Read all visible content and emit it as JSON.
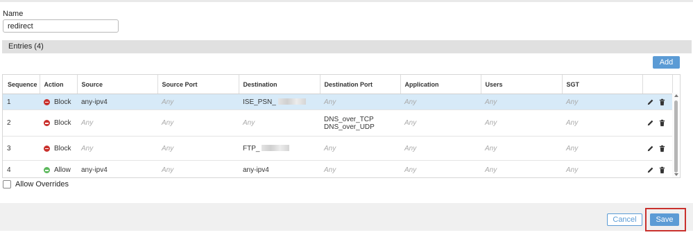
{
  "form": {
    "name_label": "Name",
    "name_value": "redirect"
  },
  "entries": {
    "header": "Entries (4)",
    "add_label": "Add",
    "columns": [
      "Sequence",
      "Action",
      "Source",
      "Source Port",
      "Destination",
      "Destination Port",
      "Application",
      "Users",
      "SGT"
    ],
    "rows": [
      {
        "sequence": "1",
        "action": "Block",
        "action_icon": "block-icon",
        "source": "any-ipv4",
        "source_port": "Any",
        "destination": "ISE_PSN_",
        "destination_redacted": true,
        "destination_port": "Any",
        "destination_port_2": "",
        "application": "Any",
        "users": "Any",
        "sgt": "Any",
        "selected": true
      },
      {
        "sequence": "2",
        "action": "Block",
        "action_icon": "block-icon",
        "source": "Any",
        "source_port": "Any",
        "destination": "Any",
        "destination_redacted": false,
        "destination_port": "DNS_over_TCP",
        "destination_port_2": "DNS_over_UDP",
        "application": "Any",
        "users": "Any",
        "sgt": "Any",
        "selected": false
      },
      {
        "sequence": "3",
        "action": "Block",
        "action_icon": "block-icon",
        "source": "Any",
        "source_port": "Any",
        "destination": "FTP_",
        "destination_redacted": true,
        "destination_port": "Any",
        "destination_port_2": "",
        "application": "Any",
        "users": "Any",
        "sgt": "Any",
        "selected": false
      },
      {
        "sequence": "4",
        "action": "Allow",
        "action_icon": "allow-icon",
        "source": "any-ipv4",
        "source_port": "Any",
        "destination": "any-ipv4",
        "destination_redacted": false,
        "destination_port": "Any",
        "destination_port_2": "",
        "application": "Any",
        "users": "Any",
        "sgt": "Any",
        "selected": false
      }
    ]
  },
  "allow_overrides_label": "Allow Overrides",
  "footer": {
    "cancel_label": "Cancel",
    "save_label": "Save"
  },
  "colors": {
    "primary_blue": "#5b9bd5",
    "block_red": "#c9302c",
    "allow_green": "#5cb85c",
    "selected_row": "#d7eaf8",
    "highlight_red": "#c9302c"
  }
}
